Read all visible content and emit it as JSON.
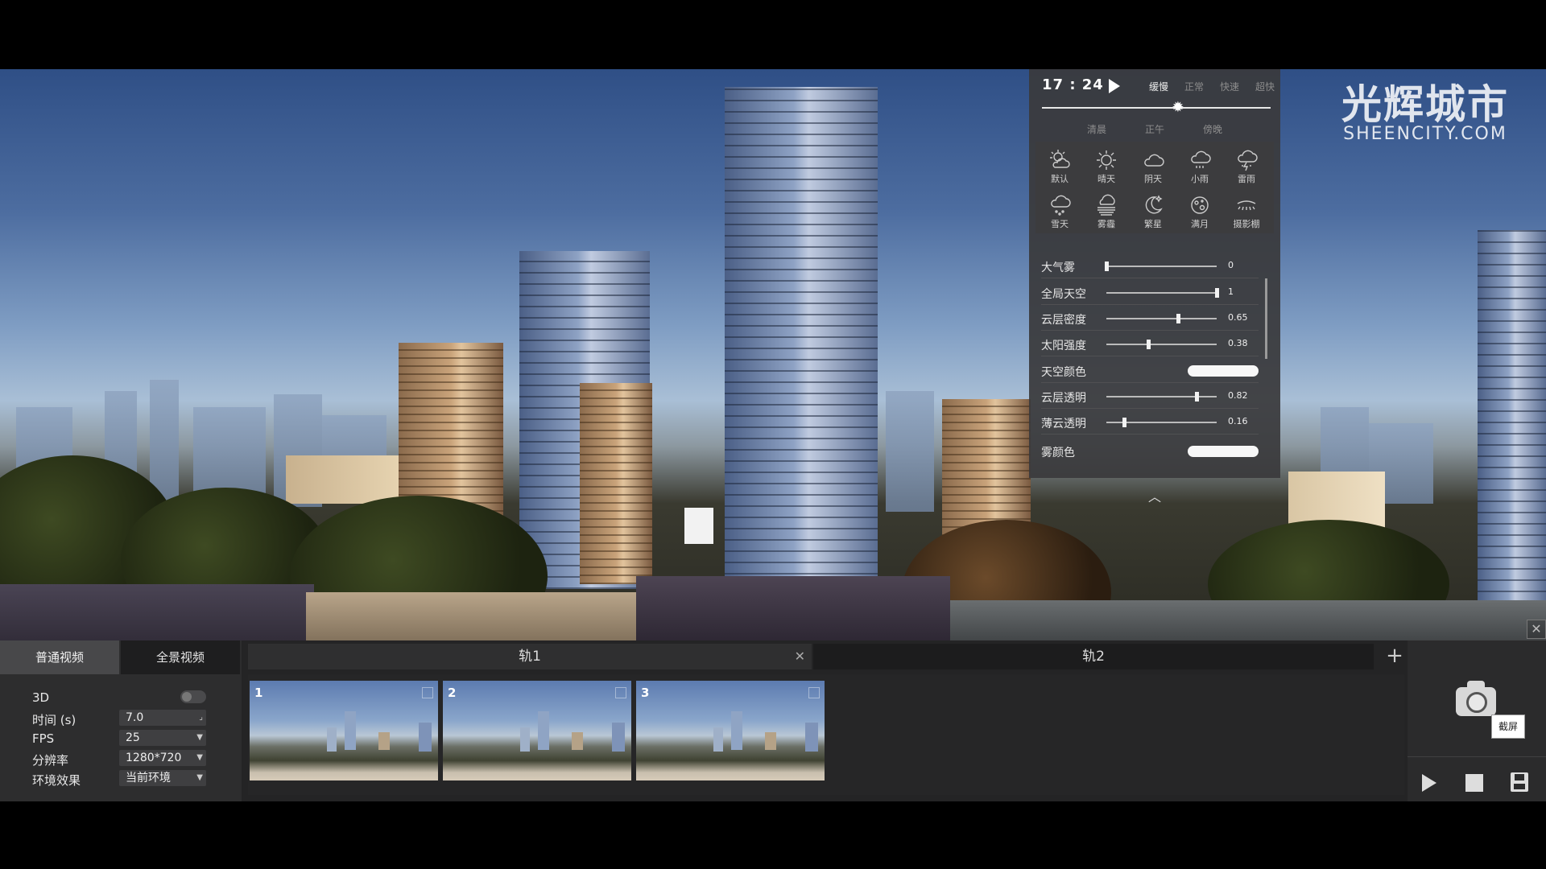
{
  "watermark": {
    "cn": "光辉城市",
    "en": "SHEENCITY.COM"
  },
  "env": {
    "clock": "17 : 24",
    "speeds": [
      "缓慢",
      "正常",
      "快速",
      "超快"
    ],
    "day_labels": [
      "清晨",
      "正午",
      "傍晚"
    ],
    "day_progress": 0.6,
    "weather": [
      {
        "label": "默认",
        "icon": "sun-cloud-icon"
      },
      {
        "label": "晴天",
        "icon": "sun-icon"
      },
      {
        "label": "阴天",
        "icon": "cloud-icon"
      },
      {
        "label": "小雨",
        "icon": "light-rain-icon"
      },
      {
        "label": "雷雨",
        "icon": "thunderstorm-icon"
      },
      {
        "label": "雪天",
        "icon": "snow-icon"
      },
      {
        "label": "雾霾",
        "icon": "fog-icon"
      },
      {
        "label": "繁星",
        "icon": "starry-moon-icon"
      },
      {
        "label": "满月",
        "icon": "full-moon-icon"
      },
      {
        "label": "摄影棚",
        "icon": "studio-light-icon"
      }
    ],
    "params": [
      {
        "label": "大气雾",
        "value": "0",
        "level": 0.0
      },
      {
        "label": "全局天空",
        "value": "1",
        "level": 1.0
      },
      {
        "label": "云层密度",
        "value": "0.65",
        "level": 0.65
      },
      {
        "label": "太阳强度",
        "value": "0.38",
        "level": 0.38
      },
      {
        "label": "天空颜色",
        "color": "#f7f7f7"
      },
      {
        "label": "云层透明",
        "value": "0.82",
        "level": 0.82
      },
      {
        "label": "薄云透明",
        "value": "0.16",
        "level": 0.16
      },
      {
        "label": "雾颜色",
        "color": "#f7f7f7"
      }
    ]
  },
  "editor": {
    "tabs": {
      "normal": "普通视频",
      "panorama": "全景视频"
    },
    "props": {
      "three_d_label": "3D",
      "time_label": "时间 (s)",
      "time_value": "7.0",
      "fps_label": "FPS",
      "fps_value": "25",
      "res_label": "分辨率",
      "res_value": "1280*720",
      "env_label": "环境效果",
      "env_value": "当前环境"
    },
    "tracks": {
      "track1": "轨1",
      "track2": "轨2"
    },
    "shots": [
      "1",
      "2",
      "3"
    ],
    "screenshot_label": "截屏"
  }
}
